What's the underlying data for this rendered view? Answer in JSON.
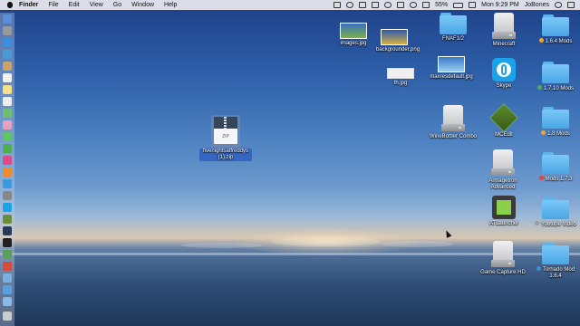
{
  "menubar": {
    "app_name": "Finder",
    "menus": [
      "File",
      "Edit",
      "View",
      "Go",
      "Window",
      "Help"
    ],
    "battery": "55%",
    "clock": "Mon 9:29 PM",
    "user": "JoBones"
  },
  "selected_file": {
    "name": "fivenightsatfreddys (1).zip",
    "type_label": "ZIP",
    "icon": "zip-archive-icon"
  },
  "desktop_icons": {
    "images_jpg": "images.jpg",
    "backgrounder_png": "backgrounder.png",
    "th_jpg": "th.jpg",
    "fnaf": "FNAF1/2",
    "maxresdefault": "maxresdefault.jpg",
    "winebottler": "WineBottler Combo",
    "minecraft": "Minecraft",
    "skype": "Skype",
    "mcedit": "MCEdit",
    "armagetron": "Armagetron Advanced",
    "atlauncher": "ATLauncher",
    "game_capture": "Game Capture HD",
    "mods_164": "1.6.4 Mods",
    "mods_1710": "1.7.10 Mods",
    "mods_18": "1.8 Mods",
    "mods_173": "Mods 1.7.3",
    "youtube_video": "Youtube Video",
    "tornado_mod": "Tornado Mod 1.6.4"
  },
  "tag_colors": {
    "orange": "#f5a623",
    "green": "#4caf50",
    "red": "#e8413c",
    "gray": "#9a9a9a",
    "blue": "#3b8ee0"
  }
}
